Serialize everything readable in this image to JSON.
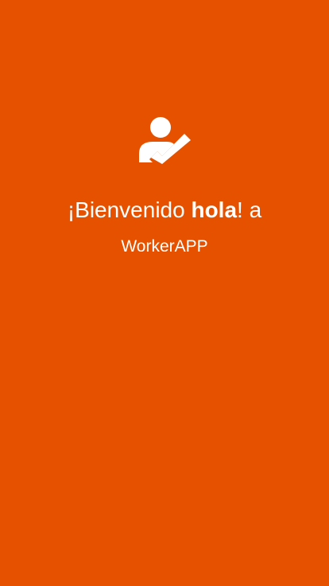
{
  "theme": {
    "background": "#e65100",
    "text_color": "#ffffff"
  },
  "header_icon": "user-check-icon",
  "welcome": {
    "prefix": "¡Bienvenido ",
    "username": "hola",
    "suffix": "! a"
  },
  "app_name": "WorkerAPP"
}
